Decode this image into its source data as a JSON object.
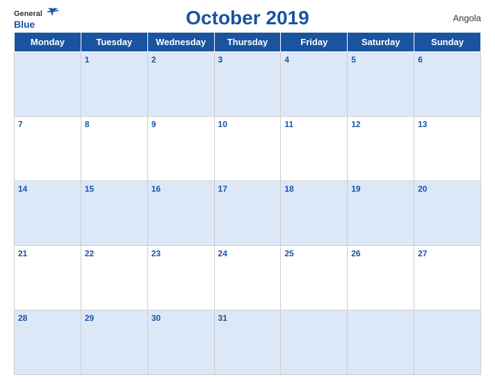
{
  "header": {
    "logo_general": "General",
    "logo_blue": "Blue",
    "title": "October 2019",
    "country": "Angola"
  },
  "weekdays": [
    "Monday",
    "Tuesday",
    "Wednesday",
    "Thursday",
    "Friday",
    "Saturday",
    "Sunday"
  ],
  "weeks": [
    [
      {
        "day": "",
        "empty": true
      },
      {
        "day": "1"
      },
      {
        "day": "2"
      },
      {
        "day": "3"
      },
      {
        "day": "4"
      },
      {
        "day": "5"
      },
      {
        "day": "6"
      }
    ],
    [
      {
        "day": "7"
      },
      {
        "day": "8"
      },
      {
        "day": "9"
      },
      {
        "day": "10"
      },
      {
        "day": "11"
      },
      {
        "day": "12"
      },
      {
        "day": "13"
      }
    ],
    [
      {
        "day": "14"
      },
      {
        "day": "15"
      },
      {
        "day": "16"
      },
      {
        "day": "17"
      },
      {
        "day": "18"
      },
      {
        "day": "19"
      },
      {
        "day": "20"
      }
    ],
    [
      {
        "day": "21"
      },
      {
        "day": "22"
      },
      {
        "day": "23"
      },
      {
        "day": "24"
      },
      {
        "day": "25"
      },
      {
        "day": "26"
      },
      {
        "day": "27"
      }
    ],
    [
      {
        "day": "28"
      },
      {
        "day": "29"
      },
      {
        "day": "30"
      },
      {
        "day": "31"
      },
      {
        "day": ""
      },
      {
        "day": ""
      },
      {
        "day": ""
      }
    ]
  ]
}
